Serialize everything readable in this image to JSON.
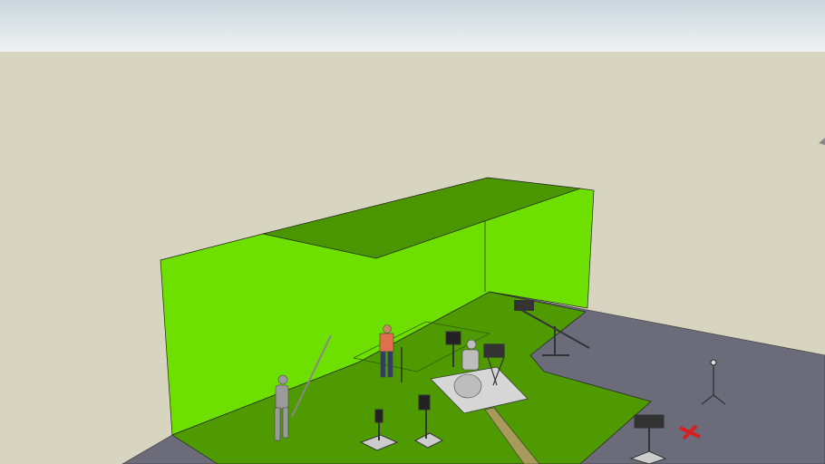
{
  "scene": {
    "colors": {
      "sky_top": "#c9d6dc",
      "sky_bottom": "#eef1f1",
      "ground": "#d7d4bf",
      "studio_floor": "#6b6b79",
      "greenscreen_wall": "#6ee000",
      "greenscreen_floor": "#4e9a00",
      "ceiling": "#4a9600",
      "platform": "#d6d6d6",
      "mark": "#d42020"
    }
  }
}
